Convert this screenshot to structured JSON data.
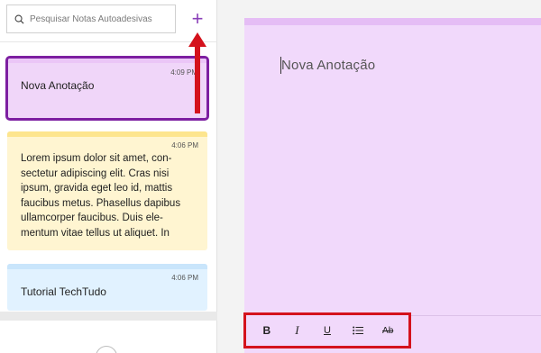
{
  "search": {
    "placeholder": "Pesquisar Notas Autoadesivas",
    "icon": "search-icon"
  },
  "add_button": {
    "label": "+",
    "icon": "plus-icon",
    "color": "#8a3fb8"
  },
  "notes": [
    {
      "time": "4:09 PM",
      "text": "Nova Anotação",
      "color": "#f0d6f9",
      "selected": true
    },
    {
      "time": "4:06 PM",
      "text": "Lorem ipsum dolor sit amet, con-sectetur adipiscing elit. Cras nisi ipsum, gravida eget leo id, mattis faucibus metus. Phasellus dapibus ullamcorper faucibus. Duis ele-mentum vitae tellus ut aliquet. In",
      "color": "#fff5d1"
    },
    {
      "time": "4:06 PM",
      "text": "Tutorial TechTudo",
      "color": "#e1f2ff"
    }
  ],
  "editor": {
    "title": "Nova Anotação",
    "background": "#f1d9fb"
  },
  "toolbar": {
    "bold": "B",
    "italic": "I",
    "underline": "U",
    "list_icon": "bullet-list-icon",
    "strike": "Ab"
  },
  "highlight_color": "#d4121c"
}
